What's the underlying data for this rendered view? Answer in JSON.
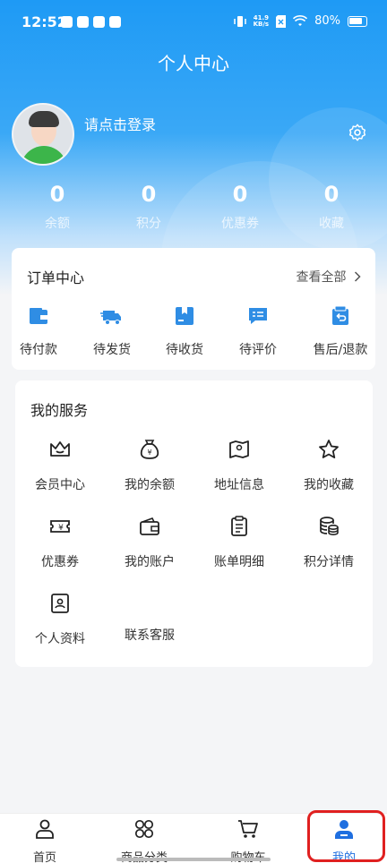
{
  "status_bar": {
    "time": "12:52",
    "net_speed_value": "41.9",
    "net_speed_unit": "KB/s",
    "battery": "80%"
  },
  "header": {
    "title": "个人中心"
  },
  "profile": {
    "login_prompt": "请点击登录"
  },
  "stats": [
    {
      "value": "0",
      "label": "余额"
    },
    {
      "value": "0",
      "label": "积分"
    },
    {
      "value": "0",
      "label": "优惠券"
    },
    {
      "value": "0",
      "label": "收藏"
    }
  ],
  "orders": {
    "title": "订单中心",
    "view_all": "查看全部",
    "items": [
      {
        "label": "待付款",
        "icon": "wallet-icon"
      },
      {
        "label": "待发货",
        "icon": "truck-icon"
      },
      {
        "label": "待收货",
        "icon": "package-icon"
      },
      {
        "label": "待评价",
        "icon": "review-icon"
      },
      {
        "label": "售后/退款",
        "icon": "refund-icon"
      }
    ]
  },
  "services": {
    "title": "我的服务",
    "items": [
      {
        "label": "会员中心",
        "icon": "crown-icon"
      },
      {
        "label": "我的余额",
        "icon": "money-bag-icon"
      },
      {
        "label": "地址信息",
        "icon": "map-icon"
      },
      {
        "label": "我的收藏",
        "icon": "star-icon"
      },
      {
        "label": "优惠券",
        "icon": "coupon-icon"
      },
      {
        "label": "我的账户",
        "icon": "wallet-icon"
      },
      {
        "label": "账单明细",
        "icon": "clipboard-icon"
      },
      {
        "label": "积分详情",
        "icon": "coins-icon"
      },
      {
        "label": "个人资料",
        "icon": "profile-card-icon"
      },
      {
        "label": "联系客服",
        "icon": ""
      }
    ]
  },
  "tabbar": {
    "items": [
      {
        "label": "首页",
        "icon": "home-person-icon"
      },
      {
        "label": "商品分类",
        "icon": "grid-icon"
      },
      {
        "label": "购物车",
        "icon": "cart-icon"
      },
      {
        "label": "我的",
        "icon": "user-icon"
      }
    ],
    "active": "我的"
  },
  "colors": {
    "primary": "#1e9af5",
    "icon_blue": "#2f8de4",
    "tab_active": "#1f6fe0",
    "highlight": "#e02020"
  }
}
